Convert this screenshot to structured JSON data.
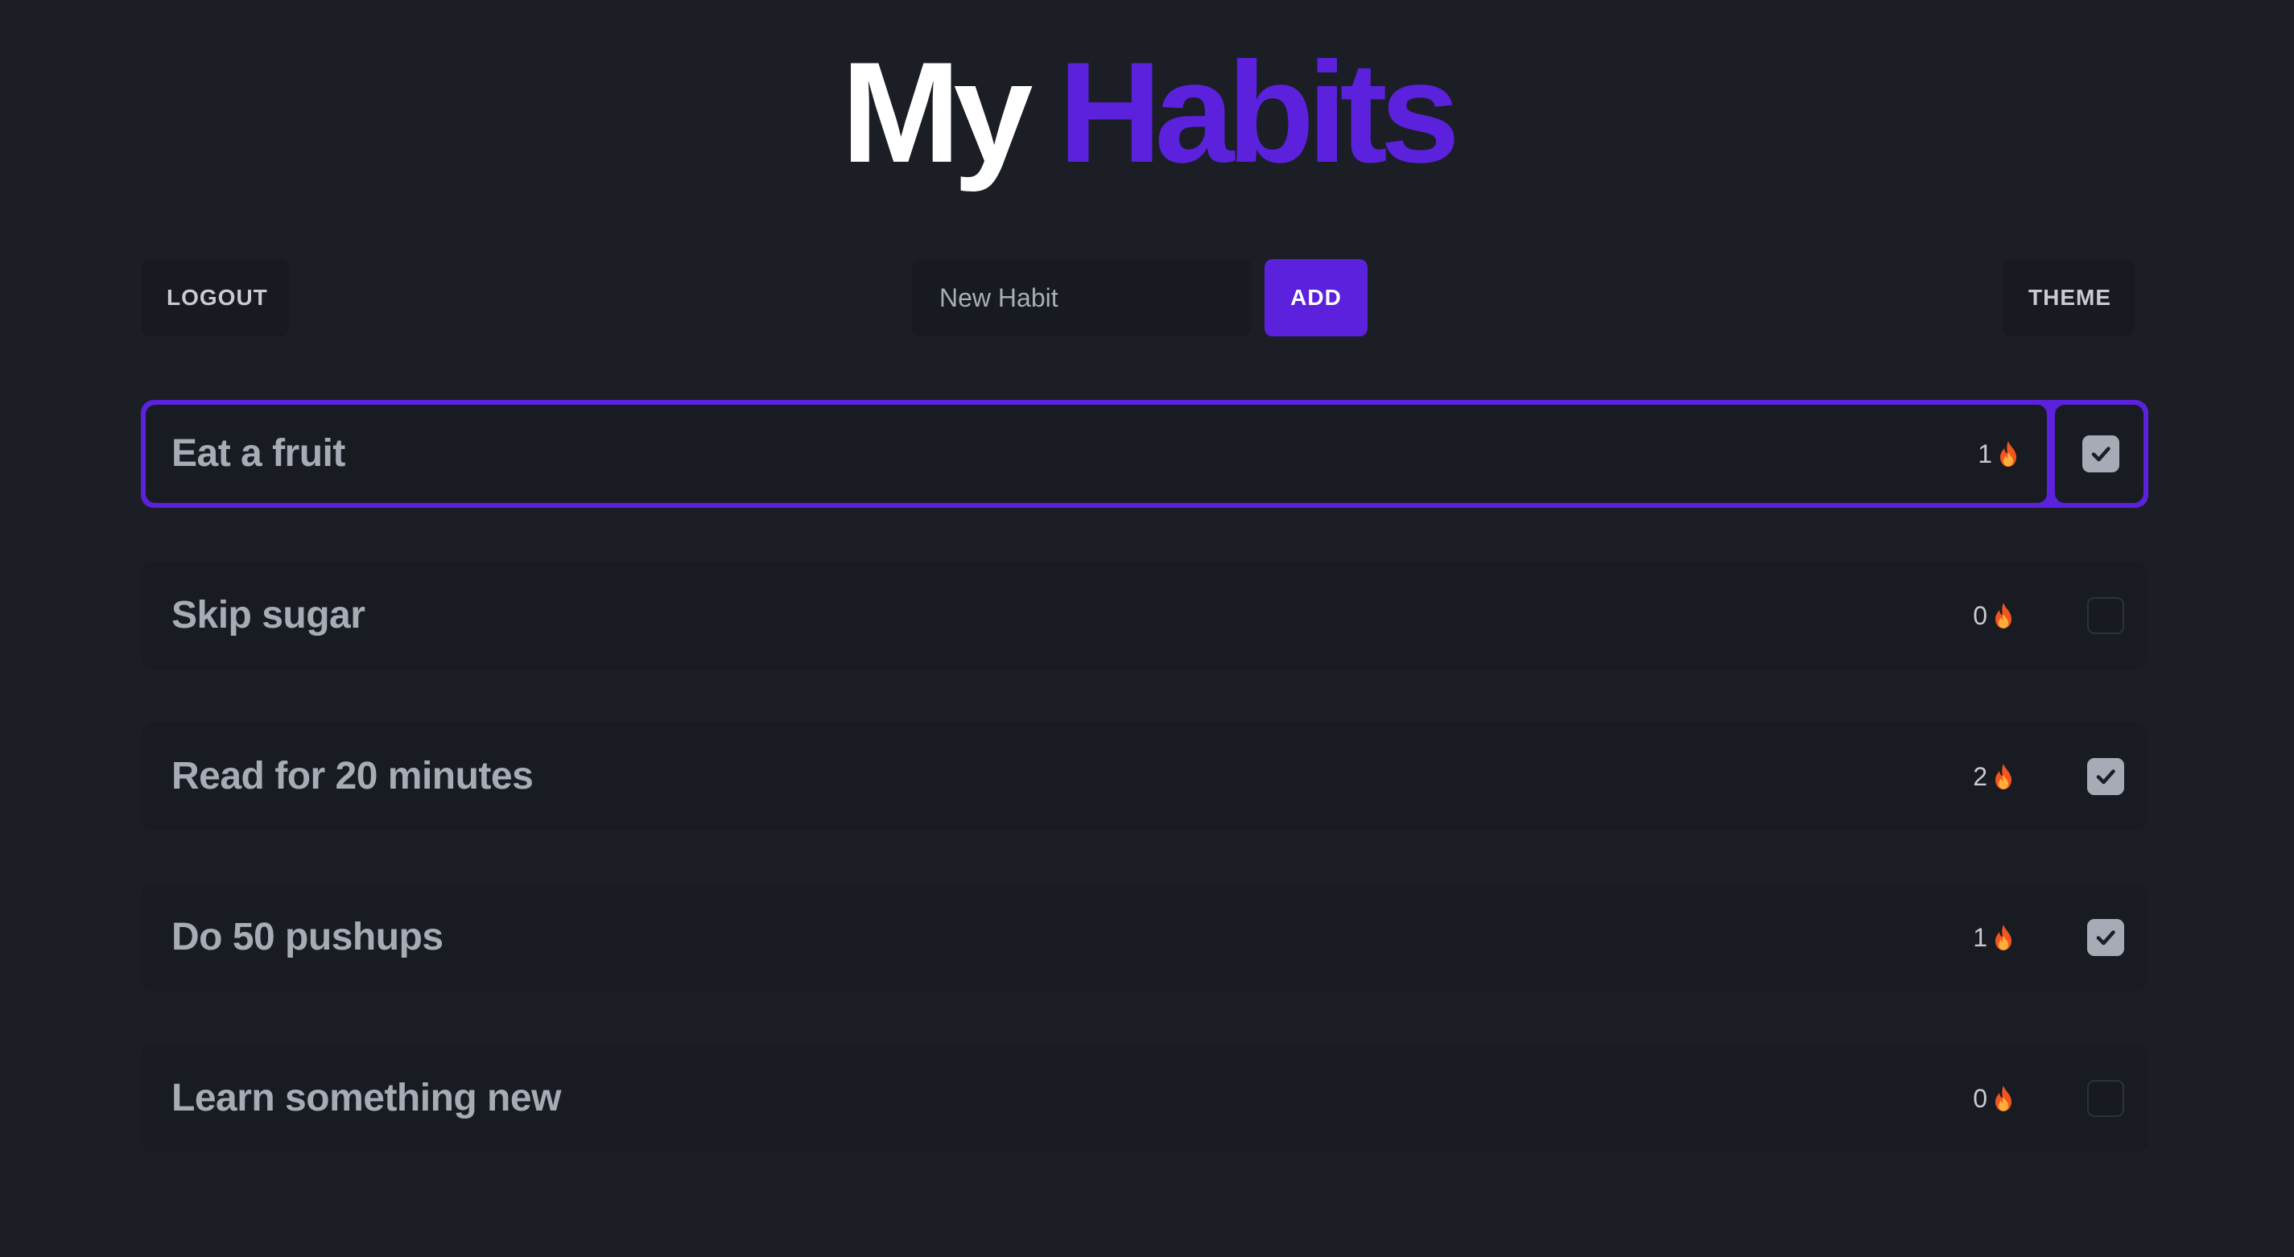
{
  "header": {
    "title_word1": "My",
    "title_word2": "Habits"
  },
  "toolbar": {
    "logout_label": "LOGOUT",
    "new_habit_placeholder": "New Habit",
    "new_habit_value": "",
    "add_label": "ADD",
    "theme_label": "THEME"
  },
  "colors": {
    "accent": "#5b21dd",
    "background": "#1b1e25",
    "card": "#181b21",
    "text_muted": "#a6abb5"
  },
  "habits": [
    {
      "name": "Eat a fruit",
      "streak": "1",
      "checked": true,
      "selected": true,
      "streak_icon": "fire-icon"
    },
    {
      "name": "Skip sugar",
      "streak": "0",
      "checked": false,
      "selected": false,
      "streak_icon": "fire-icon"
    },
    {
      "name": "Read for 20 minutes",
      "streak": "2",
      "checked": true,
      "selected": false,
      "streak_icon": "fire-icon"
    },
    {
      "name": "Do 50 pushups",
      "streak": "1",
      "checked": true,
      "selected": false,
      "streak_icon": "fire-icon"
    },
    {
      "name": "Learn something new",
      "streak": "0",
      "checked": false,
      "selected": false,
      "streak_icon": "fire-icon"
    }
  ]
}
